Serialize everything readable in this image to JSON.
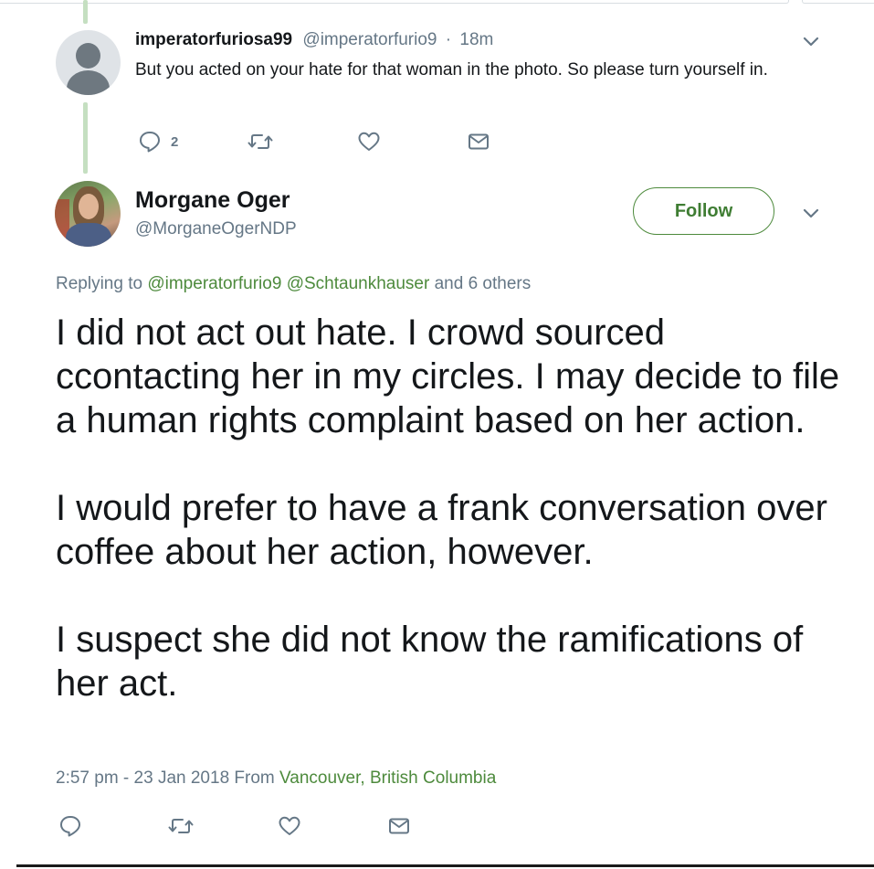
{
  "reply": {
    "display_name": "imperatorfuriosa99",
    "handle": "@imperatorfurio9",
    "separator": "·",
    "time_ago": "18m",
    "text": "But you acted on your hate for that woman in the photo.  So please turn yourself in.",
    "actions": {
      "reply_count": "2",
      "reply_icon": "reply-icon",
      "retweet_icon": "retweet-icon",
      "like_icon": "heart-icon",
      "dm_icon": "envelope-icon"
    }
  },
  "tweet": {
    "author_name": "Morgane Oger",
    "author_handle": "@MorganeOgerNDP",
    "follow_label": "Follow",
    "replying_prefix": "Replying to",
    "replying_user1": "@imperatorfurio9",
    "replying_user2": "@Schtaunkhauser",
    "replying_suffix": "and 6 others",
    "paragraph1": "I did not act out hate. I crowd sourced ccontacting her in my circles. I may decide to file a human rights complaint based on her action.",
    "paragraph2": "I would prefer to have a frank conversation over coffee about her action, however.",
    "paragraph3": "I suspect she did not know the ramifications of her act.",
    "timestamp": "2:57 pm - 23 Jan 2018 From",
    "location": "Vancouver, British Columbia"
  },
  "colors": {
    "accent_green": "#4d8a3c",
    "thread_line": "#c5dfc1",
    "muted_text": "#657786",
    "main_text": "#14171a"
  }
}
